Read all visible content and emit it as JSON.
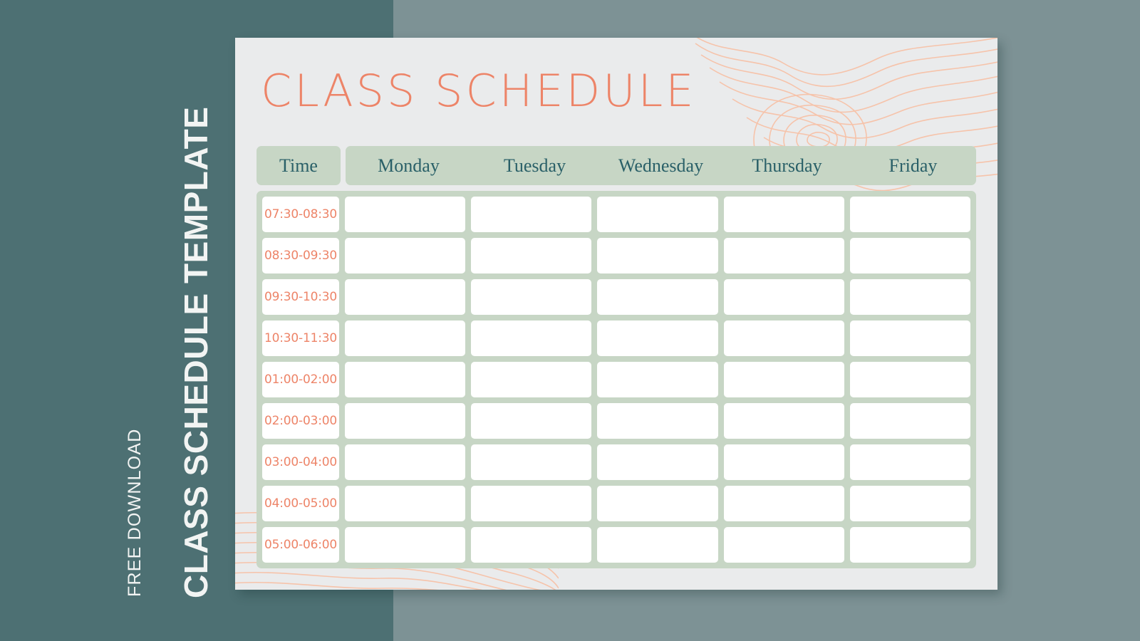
{
  "sidebar": {
    "title": "CLASS SCHEDULE TEMPLATE",
    "subtitle": "FREE DOWNLOAD",
    "background_color": "#4d7073",
    "text_color": "#f2f4f3"
  },
  "page": {
    "background_color": "#7d9295",
    "card_background_color": "#eaebec"
  },
  "card": {
    "title": "CLASS  SCHEDULE",
    "title_color": "#ed8468",
    "decoration": "topographic-contour-lines",
    "decoration_color": "#f6c3aa"
  },
  "schedule": {
    "header_background_color": "#c7d6c5",
    "header_text_color": "#2a6068",
    "cell_background_color": "#ffffff",
    "time_text_color": "#ed8468",
    "time_column_label": "Time",
    "days": [
      "Monday",
      "Tuesday",
      "Wednesday",
      "Thursday",
      "Friday"
    ],
    "time_slots": [
      "07:30-08:30",
      "08:30-09:30",
      "09:30-10:30",
      "10:30-11:30",
      "01:00-02:00",
      "02:00-03:00",
      "03:00-04:00",
      "04:00-05:00",
      "05:00-06:00"
    ],
    "entries": [
      [
        "",
        "",
        "",
        "",
        ""
      ],
      [
        "",
        "",
        "",
        "",
        ""
      ],
      [
        "",
        "",
        "",
        "",
        ""
      ],
      [
        "",
        "",
        "",
        "",
        ""
      ],
      [
        "",
        "",
        "",
        "",
        ""
      ],
      [
        "",
        "",
        "",
        "",
        ""
      ],
      [
        "",
        "",
        "",
        "",
        ""
      ],
      [
        "",
        "",
        "",
        "",
        ""
      ],
      [
        "",
        "",
        "",
        "",
        ""
      ]
    ]
  }
}
